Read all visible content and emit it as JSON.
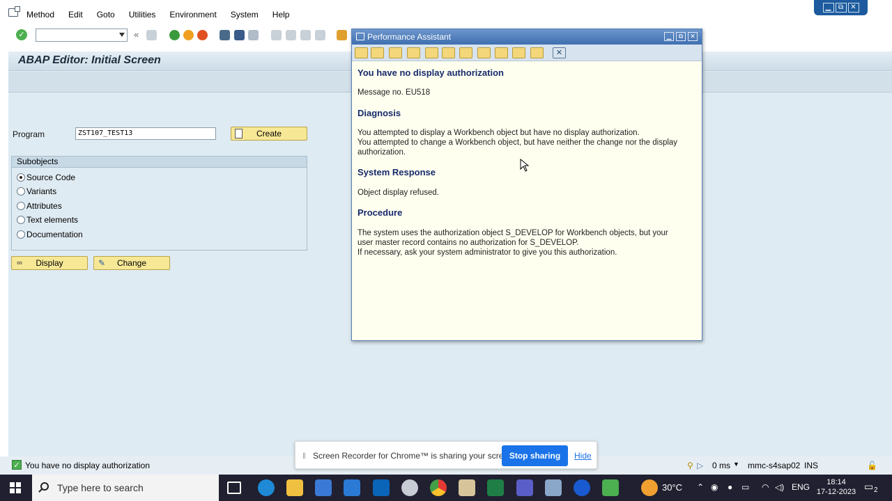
{
  "menu": {
    "items": [
      "Method",
      "Edit",
      "Goto",
      "Utilities",
      "Environment",
      "System",
      "Help"
    ]
  },
  "window_controls": [
    "▁",
    "⧉",
    "✕"
  ],
  "main": {
    "title": "ABAP Editor: Initial Screen",
    "program_label": "Program",
    "program_value": "ZST107_TEST13",
    "create_label": "Create",
    "subobjects_title": "Subobjects",
    "subobjects": [
      {
        "label": "Source Code",
        "selected": true
      },
      {
        "label": "Variants",
        "selected": false
      },
      {
        "label": "Attributes",
        "selected": false
      },
      {
        "label": "Text elements",
        "selected": false
      },
      {
        "label": "Documentation",
        "selected": false
      }
    ],
    "display_label": "Display",
    "change_label": "Change"
  },
  "assistant": {
    "window_title": "Performance Assistant",
    "heading": "You have no display authorization",
    "message_no": "Message no. EU518",
    "diagnosis_title": "Diagnosis",
    "diagnosis_line1": "You attempted to display a Workbench object but have no display authorization.",
    "diagnosis_line2": "You attempted to change a Workbench object, but have neither the change nor the display",
    "diagnosis_line3": "authorization.",
    "response_title": "System Response",
    "response_text": "Object display refused.",
    "procedure_title": "Procedure",
    "procedure_line1": "The system uses the authorization object S_DEVELOP for Workbench objects, but your",
    "procedure_line2": "user master record contains no authorization for S_DEVELOP.",
    "procedure_line3": "If necessary, ask your system administrator to give you this authorization."
  },
  "status": {
    "message": "You have no display authorization",
    "response_time": "0 ms",
    "server": "mmc-s4sap02",
    "mode": "INS"
  },
  "recorder": {
    "message": "Screen Recorder for Chrome™ is sharing your screen.",
    "stop_label": "Stop sharing",
    "hide_label": "Hide"
  },
  "taskbar": {
    "search_placeholder": "Type here to search",
    "temperature": "30°C",
    "language": "ENG",
    "time": "18:14",
    "date": "17-12-2023",
    "notification_count": "2"
  },
  "colors": {
    "sap_background": "#dfebf2",
    "button_yellow": "#f7e896",
    "assistant_title": "#3f6fb0",
    "heading_blue": "#172a6b",
    "stop_button": "#1a73e8",
    "taskbar": "#202030"
  }
}
